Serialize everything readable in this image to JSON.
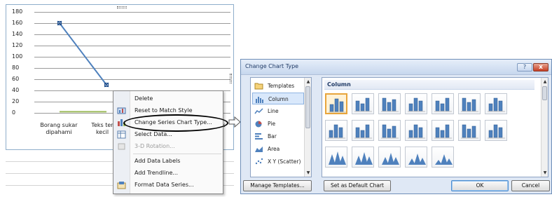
{
  "chart": {
    "y_ticks": [
      "180",
      "160",
      "140",
      "120",
      "100",
      "80",
      "60",
      "40",
      "20",
      "0"
    ],
    "categories": [
      {
        "line1": "Borang sukar",
        "line2": "dipahami"
      },
      {
        "line1": "Teks ter",
        "line2": "kecil"
      },
      {
        "line1": "k",
        "line2": ""
      }
    ],
    "line_color": "#4f81bd",
    "flat_series_color": "#9bbb59"
  },
  "chart_data": {
    "type": "line",
    "categories": [
      "Borang sukar dipahami",
      "Teks ter... kecil"
    ],
    "series": [
      {
        "values": [
          160,
          50
        ]
      },
      {
        "values": [
          2,
          2
        ]
      }
    ],
    "ylim": [
      0,
      180
    ],
    "yticks": [
      0,
      20,
      40,
      60,
      80,
      100,
      120,
      140,
      160,
      180
    ],
    "grid": true
  },
  "context_menu": {
    "items": [
      {
        "label": "Delete",
        "icon": "none",
        "disabled": false
      },
      {
        "label": "Reset to Match Style",
        "icon": "reset-style-icon",
        "disabled": false
      },
      {
        "label": "Change Series Chart Type...",
        "icon": "chart-type-icon",
        "disabled": false
      },
      {
        "label": "Select Data...",
        "icon": "select-data-icon",
        "disabled": false
      },
      {
        "label": "3-D Rotation...",
        "icon": "rotation-icon",
        "disabled": true
      },
      {
        "label": "Add Data Labels",
        "icon": "none",
        "disabled": false
      },
      {
        "label": "Add Trendline...",
        "icon": "none",
        "disabled": false
      },
      {
        "label": "Format Data Series...",
        "icon": "format-series-icon",
        "disabled": false
      }
    ]
  },
  "dialog": {
    "title": "Change Chart Type",
    "help_label": "?",
    "close_label": "x",
    "chart_types": [
      {
        "label": "Templates",
        "icon": "folder-icon"
      },
      {
        "label": "Column",
        "icon": "column-chart-icon",
        "selected": true
      },
      {
        "label": "Line",
        "icon": "line-chart-icon"
      },
      {
        "label": "Pie",
        "icon": "pie-chart-icon"
      },
      {
        "label": "Bar",
        "icon": "bar-chart-icon"
      },
      {
        "label": "Area",
        "icon": "area-chart-icon"
      },
      {
        "label": "X Y (Scatter)",
        "icon": "scatter-chart-icon"
      }
    ],
    "gallery_header": "Column",
    "buttons": {
      "manage": "Manage Templates...",
      "set_default": "Set as Default Chart",
      "ok": "OK",
      "cancel": "Cancel"
    },
    "accent_color": "#e8a53c"
  }
}
